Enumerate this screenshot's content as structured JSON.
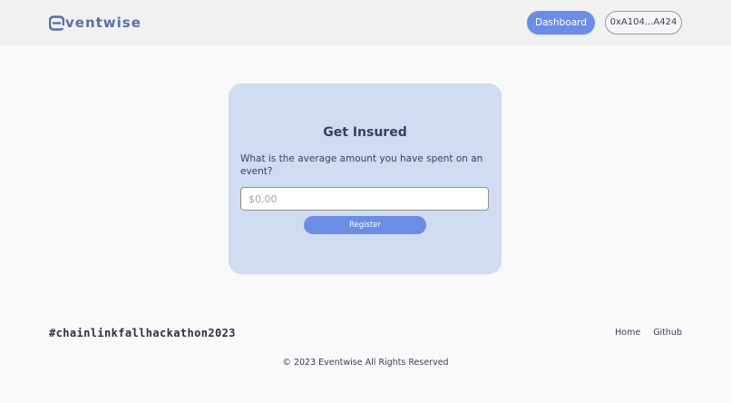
{
  "header": {
    "logo_text": "ventwise",
    "dashboard_label": "Dashboard",
    "wallet_label": "0xA104...A424"
  },
  "card": {
    "title": "Get Insured",
    "question": "What is the average amount you have spent on an event?",
    "amount_placeholder": "$0.00",
    "register_label": "Register"
  },
  "footer": {
    "hashtag": "#chainlinkfallhackathon2023",
    "links": [
      {
        "label": "Home"
      },
      {
        "label": "Github"
      }
    ],
    "copyright": "© 2023 Eventwise All Rights Reserved"
  },
  "colors": {
    "accent": "#6b8de6",
    "card_background": "#d0dcf1",
    "logo": "#5b6fa8",
    "text": "#3a3f5c"
  },
  "icons": {
    "logo_mark": "eventwise-e-logo-icon"
  }
}
